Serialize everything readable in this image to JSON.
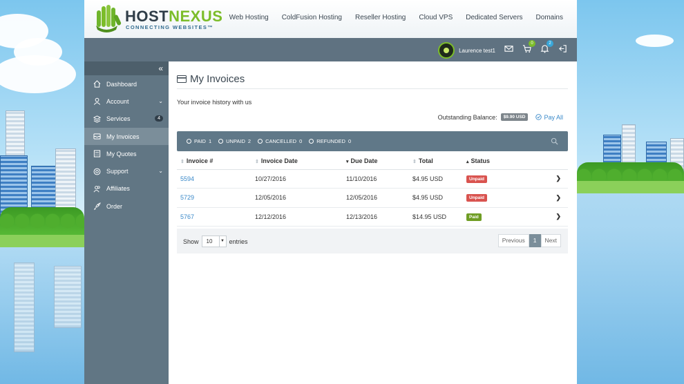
{
  "brand": {
    "name_a": "HOST",
    "name_b": "NEXUS",
    "tagline": "CONNECTING WEBSITES™"
  },
  "topnav": [
    "Web Hosting",
    "ColdFusion Hosting",
    "Reseller Hosting",
    "Cloud VPS",
    "Dedicated Servers",
    "Domains"
  ],
  "user": {
    "name": "Laurence test1",
    "cart_count": "0",
    "notification_count": "2"
  },
  "sidebar": {
    "collapse_icon": "«",
    "items": [
      {
        "label": "Dashboard",
        "icon": "home-icon"
      },
      {
        "label": "Account",
        "icon": "user-icon",
        "chevron": "⌄"
      },
      {
        "label": "Services",
        "icon": "layers-icon",
        "count": "4"
      },
      {
        "label": "My Invoices",
        "icon": "invoice-icon",
        "active": true
      },
      {
        "label": "My Quotes",
        "icon": "calculator-icon"
      },
      {
        "label": "Support",
        "icon": "lifebuoy-icon",
        "chevron": "⌄"
      },
      {
        "label": "Affiliates",
        "icon": "users-icon"
      },
      {
        "label": "Order",
        "icon": "rocket-icon"
      }
    ]
  },
  "page": {
    "title": "My Invoices",
    "subtitle": "Your invoice history with us",
    "balance_label": "Outstanding Balance:",
    "balance_amount": "$9.90 USD",
    "pay_all": "Pay All"
  },
  "filters": [
    {
      "label": "PAID",
      "count": "1"
    },
    {
      "label": "UNPAID",
      "count": "2"
    },
    {
      "label": "CANCELLED",
      "count": "0"
    },
    {
      "label": "REFUNDED",
      "count": "0"
    }
  ],
  "table": {
    "headers": [
      "Invoice #",
      "Invoice Date",
      "Due Date",
      "Total",
      "Status"
    ],
    "header_sort": [
      "⇕",
      "⇕",
      "▾",
      "⇕",
      "▴"
    ],
    "rows": [
      {
        "invoice": "5594",
        "date": "10/27/2016",
        "due": "11/10/2016",
        "total": "$4.95 USD",
        "status": "Unpaid"
      },
      {
        "invoice": "5729",
        "date": "12/05/2016",
        "due": "12/05/2016",
        "total": "$4.95 USD",
        "status": "Unpaid"
      },
      {
        "invoice": "5767",
        "date": "12/12/2016",
        "due": "12/13/2016",
        "total": "$14.95 USD",
        "status": "Paid"
      }
    ]
  },
  "footer": {
    "show_label": "Show",
    "page_size": "10",
    "entries_label": "entries",
    "prev": "Previous",
    "current_page": "1",
    "next": "Next"
  },
  "colors": {
    "accent": "#7cbd2a",
    "sidebar": "#617684",
    "link": "#3a89c9",
    "unpaid": "#d9534f",
    "paid": "#6f9d24"
  }
}
